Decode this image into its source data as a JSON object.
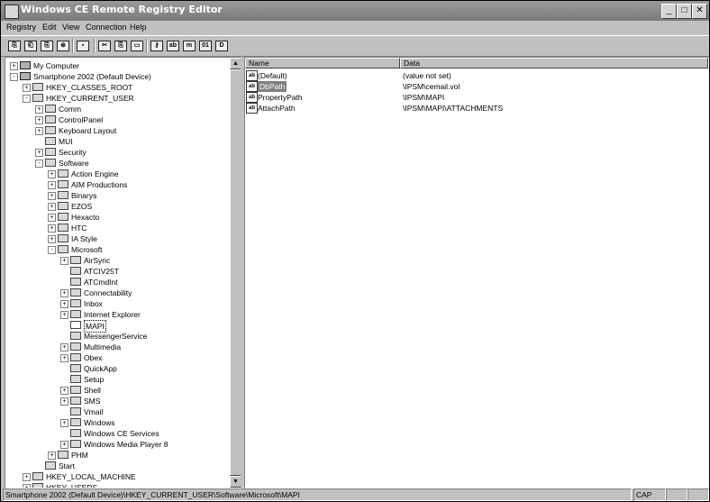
{
  "window": {
    "title": "Windows CE Remote Registry Editor"
  },
  "menubar": [
    "Registry",
    "Edit",
    "View",
    "Connection",
    "Help"
  ],
  "toolbar": [
    {
      "name": "connect-icon",
      "glyph": "⎘"
    },
    {
      "name": "disconnect-icon",
      "glyph": "⎗"
    },
    {
      "name": "new-key-icon",
      "glyph": "⎘"
    },
    {
      "name": "connect-device-icon",
      "glyph": "⊛"
    },
    {
      "name": "save-icon",
      "glyph": "▪"
    },
    {
      "name": "cut-icon",
      "glyph": "✂"
    },
    {
      "name": "copy-icon",
      "glyph": "⎘"
    },
    {
      "name": "paste-icon",
      "glyph": "▭"
    },
    {
      "name": "key-icon",
      "glyph": "⚷"
    },
    {
      "name": "string-value-icon",
      "glyph": "ab"
    },
    {
      "name": "multi-string-value-icon",
      "glyph": "m"
    },
    {
      "name": "binary-value-icon",
      "glyph": "01"
    },
    {
      "name": "dword-value-icon",
      "glyph": "D"
    }
  ],
  "tree": [
    {
      "label": "My Computer",
      "depth": 0,
      "exp": "+",
      "icon": "pc"
    },
    {
      "label": "Smartphone 2002 (Default Device)",
      "depth": 0,
      "exp": "-",
      "icon": "pc"
    },
    {
      "label": "HKEY_CLASSES_ROOT",
      "depth": 1,
      "exp": "+",
      "icon": "folder"
    },
    {
      "label": "HKEY_CURRENT_USER",
      "depth": 1,
      "exp": "-",
      "icon": "folder"
    },
    {
      "label": "Comm",
      "depth": 2,
      "exp": "+",
      "icon": "folder"
    },
    {
      "label": "ControlPanel",
      "depth": 2,
      "exp": "+",
      "icon": "folder"
    },
    {
      "label": "Keyboard Layout",
      "depth": 2,
      "exp": "+",
      "icon": "folder"
    },
    {
      "label": "MUI",
      "depth": 2,
      "exp": "",
      "icon": "folder"
    },
    {
      "label": "Security",
      "depth": 2,
      "exp": "+",
      "icon": "folder"
    },
    {
      "label": "Software",
      "depth": 2,
      "exp": "-",
      "icon": "folder"
    },
    {
      "label": "Action Engine",
      "depth": 3,
      "exp": "+",
      "icon": "folder"
    },
    {
      "label": "AIM Productions",
      "depth": 3,
      "exp": "+",
      "icon": "folder"
    },
    {
      "label": "Binarys",
      "depth": 3,
      "exp": "+",
      "icon": "folder"
    },
    {
      "label": "EZOS",
      "depth": 3,
      "exp": "+",
      "icon": "folder"
    },
    {
      "label": "Hexacto",
      "depth": 3,
      "exp": "+",
      "icon": "folder"
    },
    {
      "label": "HTC",
      "depth": 3,
      "exp": "+",
      "icon": "folder"
    },
    {
      "label": "IA Style",
      "depth": 3,
      "exp": "+",
      "icon": "folder"
    },
    {
      "label": "Microsoft",
      "depth": 3,
      "exp": "-",
      "icon": "folder"
    },
    {
      "label": "AirSync",
      "depth": 4,
      "exp": "+",
      "icon": "folder"
    },
    {
      "label": "ATCIV25T",
      "depth": 4,
      "exp": "",
      "icon": "folder"
    },
    {
      "label": "ATCmdInt",
      "depth": 4,
      "exp": "",
      "icon": "folder"
    },
    {
      "label": "Connectability",
      "depth": 4,
      "exp": "+",
      "icon": "folder"
    },
    {
      "label": "Inbox",
      "depth": 4,
      "exp": "+",
      "icon": "folder"
    },
    {
      "label": "Internet Explorer",
      "depth": 4,
      "exp": "+",
      "icon": "folder"
    },
    {
      "label": "MAPI",
      "depth": 4,
      "exp": "",
      "icon": "folder-open",
      "selected": true
    },
    {
      "label": "MessengerService",
      "depth": 4,
      "exp": "",
      "icon": "folder"
    },
    {
      "label": "Multimedia",
      "depth": 4,
      "exp": "+",
      "icon": "folder"
    },
    {
      "label": "Obex",
      "depth": 4,
      "exp": "+",
      "icon": "folder"
    },
    {
      "label": "QuickApp",
      "depth": 4,
      "exp": "",
      "icon": "folder"
    },
    {
      "label": "Setup",
      "depth": 4,
      "exp": "",
      "icon": "folder"
    },
    {
      "label": "Shell",
      "depth": 4,
      "exp": "+",
      "icon": "folder"
    },
    {
      "label": "SMS",
      "depth": 4,
      "exp": "+",
      "icon": "folder"
    },
    {
      "label": "Vmail",
      "depth": 4,
      "exp": "",
      "icon": "folder"
    },
    {
      "label": "Windows",
      "depth": 4,
      "exp": "+",
      "icon": "folder"
    },
    {
      "label": "Windows CE Services",
      "depth": 4,
      "exp": "",
      "icon": "folder"
    },
    {
      "label": "Windows Media Player 8",
      "depth": 4,
      "exp": "+",
      "icon": "folder"
    },
    {
      "label": "PHM",
      "depth": 3,
      "exp": "+",
      "icon": "folder"
    },
    {
      "label": "Start",
      "depth": 2,
      "exp": "",
      "icon": "folder"
    },
    {
      "label": "HKEY_LOCAL_MACHINE",
      "depth": 1,
      "exp": "+",
      "icon": "folder"
    },
    {
      "label": "HKEY_USERS",
      "depth": 1,
      "exp": "+",
      "icon": "folder"
    }
  ],
  "list": {
    "columns": [
      "Name",
      "Data"
    ],
    "rows": [
      {
        "name": "(Default)",
        "data": "(value not set)",
        "icon": "ab"
      },
      {
        "name": "DbPath",
        "data": "\\IPSM\\cemail.vol",
        "icon": "ab",
        "selected": true
      },
      {
        "name": "PropertyPath",
        "data": "\\IPSM\\MAPI",
        "icon": "ab"
      },
      {
        "name": "AttachPath",
        "data": "\\IPSM\\MAPI\\ATTACHMENTS",
        "icon": "ab"
      }
    ]
  },
  "status": {
    "path": "Smartphone 2002 (Default Device)\\HKEY_CURRENT_USER\\Software\\Microsoft\\MAPI",
    "cap": "CAP"
  }
}
